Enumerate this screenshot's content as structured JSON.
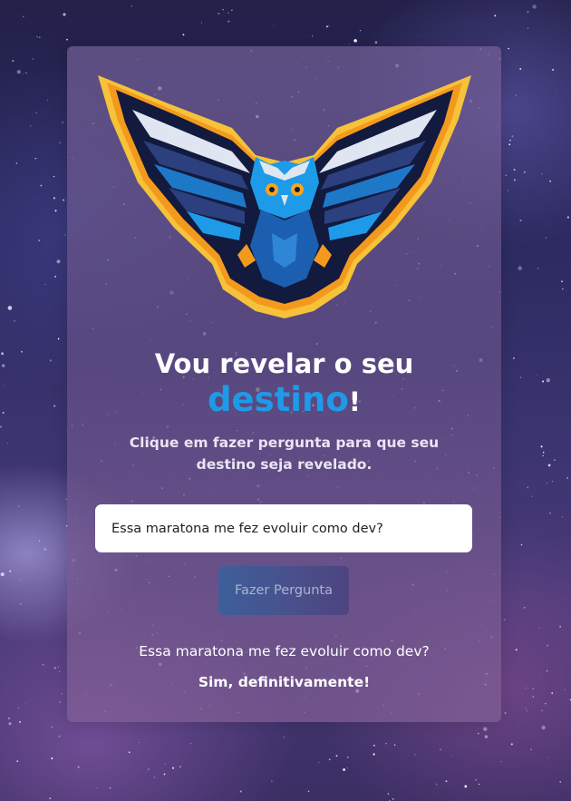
{
  "logo": {
    "icon": "owl-logo",
    "colors": {
      "outline": "#f6c23a",
      "body": "#16204a",
      "accent": "#1e9be8",
      "eyes": "#f7a51c"
    }
  },
  "header": {
    "title_line1": "Vou revelar o seu",
    "title_accent": "destino",
    "title_suffix": "!",
    "subtitle": "Clique em fazer pergunta para que seu destino seja revelado."
  },
  "form": {
    "question_value": "Essa maratona me fez evoluir como dev?",
    "question_placeholder": "",
    "ask_button_label": "Fazer Pergunta"
  },
  "result": {
    "question": "Essa maratona me fez evoluir como dev?",
    "answer": "Sim, definitivamente!"
  },
  "theme": {
    "accent": "#1e9be8",
    "button_gradient": [
      "#3d5f9a",
      "#4d4480"
    ]
  }
}
